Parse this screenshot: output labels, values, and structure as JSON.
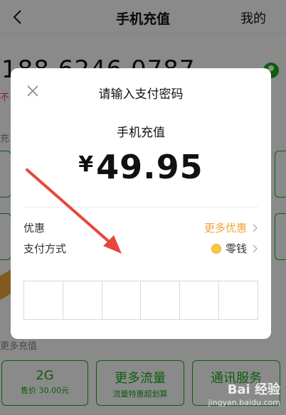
{
  "header": {
    "title": "手机充值",
    "mine_label": "我的"
  },
  "phone": {
    "number": "188 6246 0787",
    "note": "不"
  },
  "section": {
    "recharge_label": "充",
    "more_label": "更多充值"
  },
  "bottom_tiles": [
    {
      "main": "2G",
      "sub": "售价 30.00元"
    },
    {
      "main": "更多流量",
      "sub": "流量特惠超划算"
    },
    {
      "main": "通讯服务",
      "sub": ""
    }
  ],
  "modal": {
    "title": "请输入支付密码",
    "product": "手机充值",
    "currency": "¥",
    "amount": "49.95",
    "discount_label": "优惠",
    "discount_value": "更多优惠",
    "method_label": "支付方式",
    "method_value": "零钱",
    "pin_cells": 6
  },
  "watermark": {
    "logo": "Bai 经验",
    "url": "jingyan.baidu.com"
  },
  "colors": {
    "accent_green": "#1aad19",
    "orange": "#f0a43a",
    "annotation_red": "#e8463d"
  }
}
